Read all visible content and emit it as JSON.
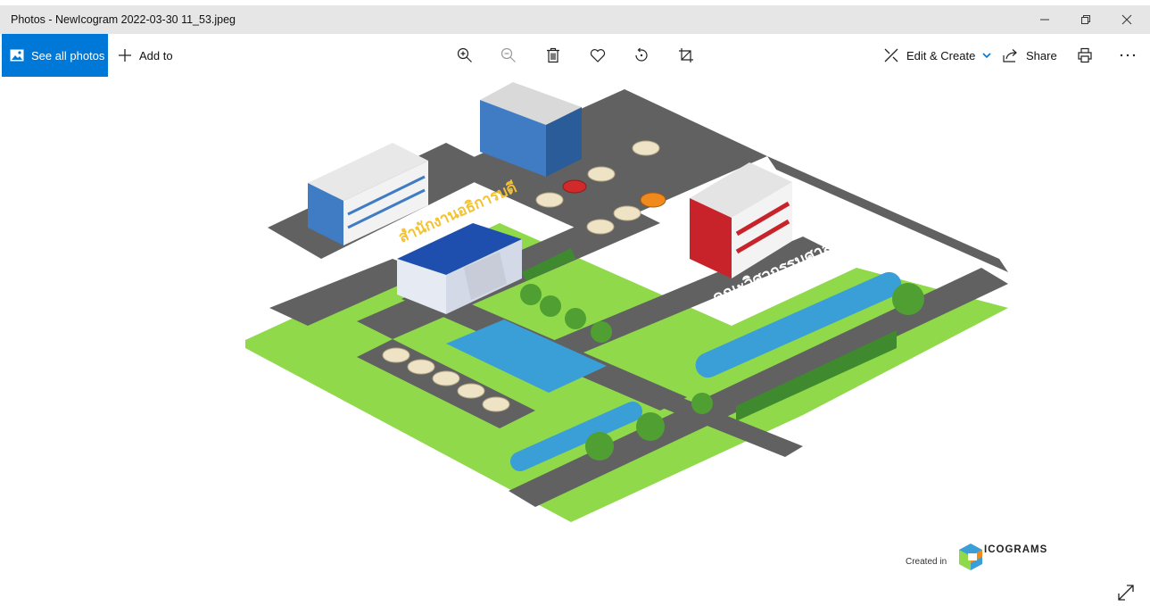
{
  "window": {
    "title": "Photos - NewIcogram 2022-03-30 11_53.jpeg",
    "controls": [
      "minimize-icon",
      "restore-icon",
      "close-icon"
    ]
  },
  "toolbar": {
    "see_all_label": "See all photos",
    "add_to_label": "Add to",
    "center_icons": [
      "zoom-in-icon",
      "zoom-out-icon",
      "delete-icon",
      "favorite-icon",
      "rotate-icon",
      "crop-icon"
    ],
    "edit_create_label": "Edit & Create",
    "share_label": "Share",
    "right_icons": [
      "print-icon",
      "more-icon"
    ]
  },
  "image": {
    "building_label_left": "สำนักงานอธิการบดี",
    "building_label_right": "คณะวิศวกรรมศาสตร์",
    "watermark_prefix": "Created in",
    "watermark_brand": "ICOGRAMS",
    "colors": {
      "accent": "#0078d7",
      "grass": "#8fd94a",
      "road": "#616161",
      "water": "#3a9fd6",
      "roof_blue": "#1f4fae",
      "red_wall": "#c8232a"
    }
  }
}
